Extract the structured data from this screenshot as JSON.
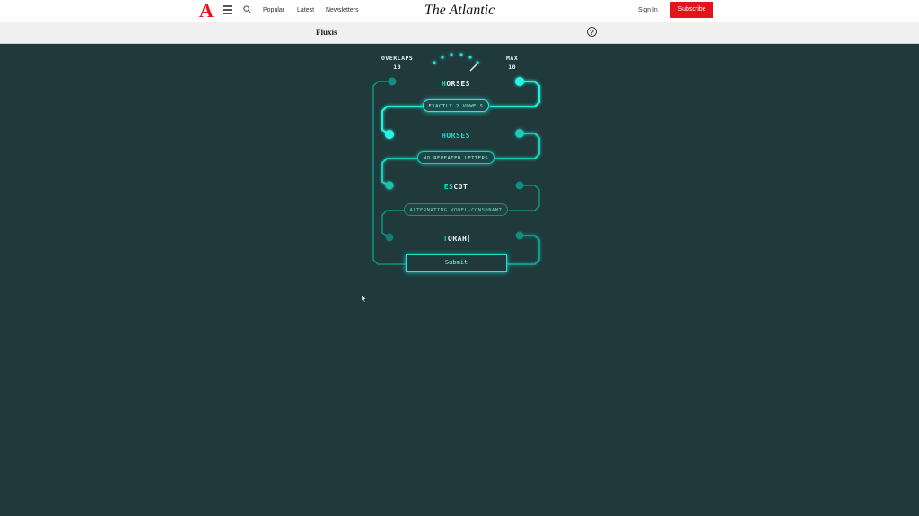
{
  "header": {
    "logo_letter": "A",
    "nav": [
      "Popular",
      "Latest",
      "Newsletters"
    ],
    "brand": "The Atlantic",
    "sign_in": "Sign In",
    "subscribe": "Subscribe"
  },
  "game": {
    "title": "Fluxis",
    "overlaps_label": "OVERLAPS",
    "overlaps_value": "10",
    "max_label": "MAX",
    "max_value": "10",
    "words": [
      {
        "highlight": "H",
        "rest": "ORSES"
      },
      {
        "highlight": "HORSES",
        "rest": ""
      },
      {
        "highlight": "ES",
        "rest": "COT"
      },
      {
        "highlight": "T",
        "rest": "ORAH"
      }
    ],
    "rules": [
      "EXACTLY 2 VOWELS",
      "NO REPEATED LETTERS",
      "ALTERNATING VOWEL-CONSONANT"
    ],
    "submit_label": "Submit"
  },
  "colors": {
    "background": "#20393b",
    "accent": "#1ff0db",
    "brand_red": "#e7131a"
  }
}
